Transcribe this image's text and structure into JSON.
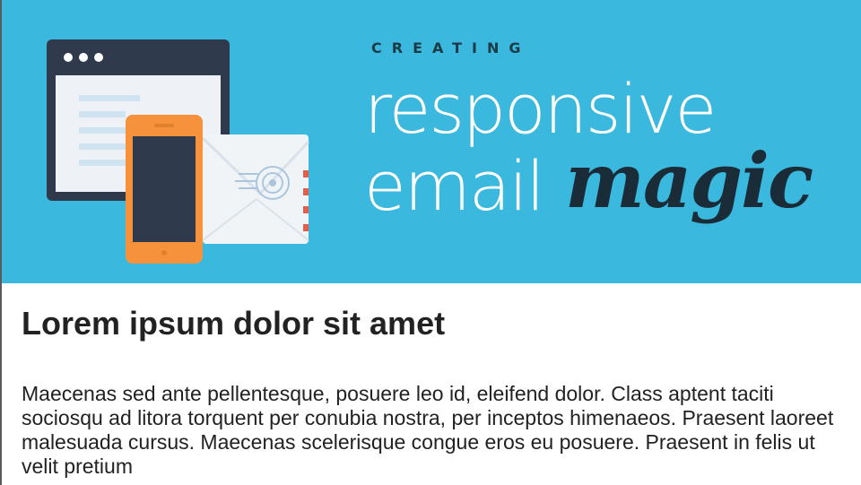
{
  "hero": {
    "tagline": "CREATING",
    "headline_line1": "responsive",
    "headline_line2": "email",
    "headline_accent": "magic",
    "background_color": "#3bb8de",
    "illustration_icons": [
      "browser-window-icon",
      "smartphone-icon",
      "envelope-icon"
    ]
  },
  "article": {
    "title": "Lorem ipsum dolor sit amet",
    "body": "Maecenas sed ante pellentesque, posuere leo id, eleifend dolor. Class aptent taciti sociosqu ad litora torquent per conubia nostra, per inceptos himenaeos. Praesent laoreet malesuada cursus. Maecenas scelerisque congue eros eu posuere. Praesent in felis ut velit pretium"
  }
}
